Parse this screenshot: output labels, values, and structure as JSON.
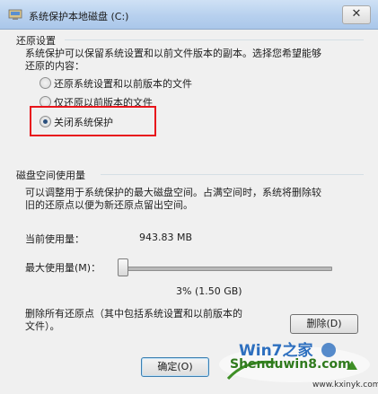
{
  "window": {
    "title": "系统保护本地磁盘 (C:)"
  },
  "restore_settings": {
    "group_title": "还原设置",
    "description": [
      "系统保护可以保留系统设置和以前文件版本的副本。选择您希望能够",
      "还原的内容："
    ],
    "options": [
      {
        "label": "还原系统设置和以前版本的文件",
        "checked": false
      },
      {
        "label": "仅还原以前版本的文件",
        "checked": false
      },
      {
        "label": "关闭系统保护",
        "checked": true
      }
    ]
  },
  "disk_space": {
    "group_title": "磁盘空间使用量",
    "description": [
      "可以调整用于系统保护的最大磁盘空间。占满空间时，系统将删除较",
      "旧的还原点以便为新还原点留出空间。"
    ],
    "current_usage_label": "当前使用量：",
    "current_usage_value": "943.83 MB",
    "max_usage_label": "最大使用量(M)：",
    "slider_percent": 3,
    "max_usage_value": "3% (1.50 GB)"
  },
  "delete_section": {
    "text": [
      "删除所有还原点（其中包括系统设置和以前版本的",
      "文件）。"
    ],
    "delete_button": "删除(D)"
  },
  "footer": {
    "ok_button": "确定(O)"
  },
  "watermark": {
    "brand": "Win7之家",
    "site_name": "Shenduwin8.com",
    "url": "www.kxinyk.com"
  },
  "colors": {
    "highlight_border": "#e8141b",
    "title_bar": "#b7d0ee",
    "watermark_green": "#3e8f26"
  }
}
